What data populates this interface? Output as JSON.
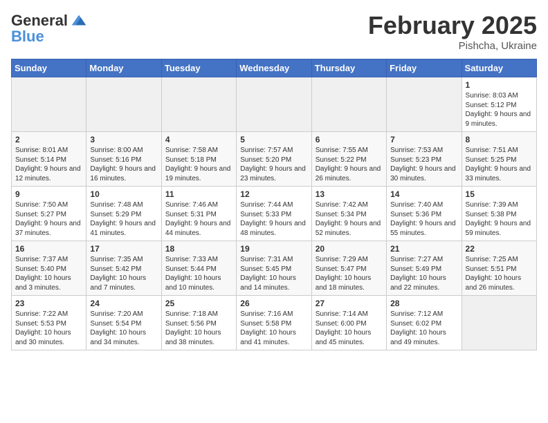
{
  "app": {
    "logo_general": "General",
    "logo_blue": "Blue",
    "title": "February 2025",
    "subtitle": "Pishcha, Ukraine"
  },
  "calendar": {
    "weekdays": [
      "Sunday",
      "Monday",
      "Tuesday",
      "Wednesday",
      "Thursday",
      "Friday",
      "Saturday"
    ],
    "weeks": [
      [
        {
          "day": "",
          "info": ""
        },
        {
          "day": "",
          "info": ""
        },
        {
          "day": "",
          "info": ""
        },
        {
          "day": "",
          "info": ""
        },
        {
          "day": "",
          "info": ""
        },
        {
          "day": "",
          "info": ""
        },
        {
          "day": "1",
          "info": "Sunrise: 8:03 AM\nSunset: 5:12 PM\nDaylight: 9 hours and 9 minutes."
        }
      ],
      [
        {
          "day": "2",
          "info": "Sunrise: 8:01 AM\nSunset: 5:14 PM\nDaylight: 9 hours and 12 minutes."
        },
        {
          "day": "3",
          "info": "Sunrise: 8:00 AM\nSunset: 5:16 PM\nDaylight: 9 hours and 16 minutes."
        },
        {
          "day": "4",
          "info": "Sunrise: 7:58 AM\nSunset: 5:18 PM\nDaylight: 9 hours and 19 minutes."
        },
        {
          "day": "5",
          "info": "Sunrise: 7:57 AM\nSunset: 5:20 PM\nDaylight: 9 hours and 23 minutes."
        },
        {
          "day": "6",
          "info": "Sunrise: 7:55 AM\nSunset: 5:22 PM\nDaylight: 9 hours and 26 minutes."
        },
        {
          "day": "7",
          "info": "Sunrise: 7:53 AM\nSunset: 5:23 PM\nDaylight: 9 hours and 30 minutes."
        },
        {
          "day": "8",
          "info": "Sunrise: 7:51 AM\nSunset: 5:25 PM\nDaylight: 9 hours and 33 minutes."
        }
      ],
      [
        {
          "day": "9",
          "info": "Sunrise: 7:50 AM\nSunset: 5:27 PM\nDaylight: 9 hours and 37 minutes."
        },
        {
          "day": "10",
          "info": "Sunrise: 7:48 AM\nSunset: 5:29 PM\nDaylight: 9 hours and 41 minutes."
        },
        {
          "day": "11",
          "info": "Sunrise: 7:46 AM\nSunset: 5:31 PM\nDaylight: 9 hours and 44 minutes."
        },
        {
          "day": "12",
          "info": "Sunrise: 7:44 AM\nSunset: 5:33 PM\nDaylight: 9 hours and 48 minutes."
        },
        {
          "day": "13",
          "info": "Sunrise: 7:42 AM\nSunset: 5:34 PM\nDaylight: 9 hours and 52 minutes."
        },
        {
          "day": "14",
          "info": "Sunrise: 7:40 AM\nSunset: 5:36 PM\nDaylight: 9 hours and 55 minutes."
        },
        {
          "day": "15",
          "info": "Sunrise: 7:39 AM\nSunset: 5:38 PM\nDaylight: 9 hours and 59 minutes."
        }
      ],
      [
        {
          "day": "16",
          "info": "Sunrise: 7:37 AM\nSunset: 5:40 PM\nDaylight: 10 hours and 3 minutes."
        },
        {
          "day": "17",
          "info": "Sunrise: 7:35 AM\nSunset: 5:42 PM\nDaylight: 10 hours and 7 minutes."
        },
        {
          "day": "18",
          "info": "Sunrise: 7:33 AM\nSunset: 5:44 PM\nDaylight: 10 hours and 10 minutes."
        },
        {
          "day": "19",
          "info": "Sunrise: 7:31 AM\nSunset: 5:45 PM\nDaylight: 10 hours and 14 minutes."
        },
        {
          "day": "20",
          "info": "Sunrise: 7:29 AM\nSunset: 5:47 PM\nDaylight: 10 hours and 18 minutes."
        },
        {
          "day": "21",
          "info": "Sunrise: 7:27 AM\nSunset: 5:49 PM\nDaylight: 10 hours and 22 minutes."
        },
        {
          "day": "22",
          "info": "Sunrise: 7:25 AM\nSunset: 5:51 PM\nDaylight: 10 hours and 26 minutes."
        }
      ],
      [
        {
          "day": "23",
          "info": "Sunrise: 7:22 AM\nSunset: 5:53 PM\nDaylight: 10 hours and 30 minutes."
        },
        {
          "day": "24",
          "info": "Sunrise: 7:20 AM\nSunset: 5:54 PM\nDaylight: 10 hours and 34 minutes."
        },
        {
          "day": "25",
          "info": "Sunrise: 7:18 AM\nSunset: 5:56 PM\nDaylight: 10 hours and 38 minutes."
        },
        {
          "day": "26",
          "info": "Sunrise: 7:16 AM\nSunset: 5:58 PM\nDaylight: 10 hours and 41 minutes."
        },
        {
          "day": "27",
          "info": "Sunrise: 7:14 AM\nSunset: 6:00 PM\nDaylight: 10 hours and 45 minutes."
        },
        {
          "day": "28",
          "info": "Sunrise: 7:12 AM\nSunset: 6:02 PM\nDaylight: 10 hours and 49 minutes."
        },
        {
          "day": "",
          "info": ""
        }
      ]
    ]
  }
}
